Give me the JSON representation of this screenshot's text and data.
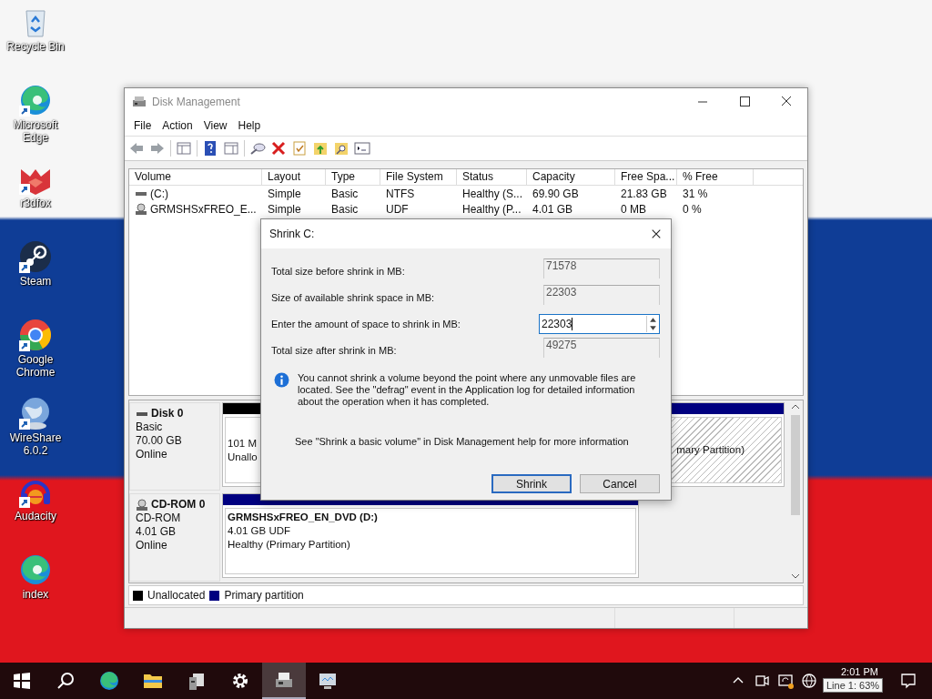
{
  "desktop": {
    "icons": [
      {
        "kind": "recycle-bin",
        "label": "Recycle Bin",
        "shortcut": false
      },
      {
        "kind": "edge",
        "label": "Microsoft Edge",
        "shortcut": true
      },
      {
        "kind": "fox",
        "label": "r3dfox",
        "shortcut": true
      },
      {
        "kind": "steam",
        "label": "Steam",
        "shortcut": true
      },
      {
        "kind": "chrome",
        "label": "Google Chrome",
        "shortcut": true
      },
      {
        "kind": "globe",
        "label": "WireShare 6.0.2",
        "shortcut": true
      },
      {
        "kind": "headphones",
        "label": "Audacity",
        "shortcut": true
      },
      {
        "kind": "edge",
        "label": "index",
        "shortcut": false
      }
    ]
  },
  "window": {
    "title": "Disk Management",
    "menu": [
      "File",
      "Action",
      "View",
      "Help"
    ],
    "volumes": {
      "columns": [
        "Volume",
        "Layout",
        "Type",
        "File System",
        "Status",
        "Capacity",
        "Free Spa...",
        "% Free"
      ],
      "rows": [
        {
          "kind": "drive",
          "cells": [
            "(C:)",
            "Simple",
            "Basic",
            "NTFS",
            "Healthy (S...",
            "69.90 GB",
            "21.83 GB",
            "31 %"
          ]
        },
        {
          "kind": "cd",
          "cells": [
            "GRMSHSxFREO_E...",
            "Simple",
            "Basic",
            "UDF",
            "Healthy (P...",
            "4.01 GB",
            "0 MB",
            "0 %"
          ]
        }
      ]
    },
    "disks": [
      {
        "kind": "drive",
        "name": "Disk 0",
        "type": "Basic",
        "size": "70.00 GB",
        "status": "Online",
        "partitions": [
          {
            "color": "#000000",
            "selected": false,
            "lines": [
              "101 M",
              "Unallo"
            ]
          },
          {
            "color": "#000080",
            "selected": true,
            "lines": [
              "mary Partition)"
            ]
          }
        ]
      },
      {
        "kind": "cd",
        "name": "CD-ROM 0",
        "type": "CD-ROM",
        "size": "4.01 GB",
        "status": "Online",
        "partitions": [
          {
            "color": "#000080",
            "selected": false,
            "title": "GRMSHSxFREO_EN_DVD  (D:)",
            "lines": [
              "4.01 GB UDF",
              "Healthy (Primary Partition)"
            ]
          }
        ]
      }
    ],
    "legend": [
      {
        "label": "Unallocated",
        "color": "#000000"
      },
      {
        "label": "Primary partition",
        "color": "#000080"
      }
    ]
  },
  "dialog": {
    "title": "Shrink C:",
    "fields": [
      {
        "kind": "readonly",
        "label": "Total size before shrink in MB:",
        "value": "71578"
      },
      {
        "kind": "readonly",
        "label": "Size of available shrink space in MB:",
        "value": "22303"
      },
      {
        "kind": "spinner",
        "label": "Enter the amount of space to shrink in MB:",
        "value": "22303"
      },
      {
        "kind": "readonly",
        "label": "Total size after shrink in MB:",
        "value": "49275"
      }
    ],
    "info": "You cannot shrink a volume beyond the point where any unmovable files are located. See the \"defrag\" event in the Application log for detailed information about the operation when it has completed.",
    "help": "See \"Shrink a basic volume\" in Disk Management help for more information",
    "buttons": [
      {
        "label": "Shrink",
        "default": true
      },
      {
        "label": "Cancel",
        "default": false
      }
    ]
  },
  "taskbar": {
    "items": [
      {
        "kind": "start",
        "selected": false
      },
      {
        "kind": "search",
        "selected": false
      },
      {
        "kind": "edge",
        "selected": false
      },
      {
        "kind": "folder",
        "selected": false
      },
      {
        "kind": "cabinet",
        "selected": false
      },
      {
        "kind": "gear",
        "selected": false
      },
      {
        "kind": "disk",
        "selected": true
      },
      {
        "kind": "monitor",
        "selected": false
      }
    ],
    "clock": "2:01 PM",
    "tooltip": "Line 1: 63%"
  }
}
